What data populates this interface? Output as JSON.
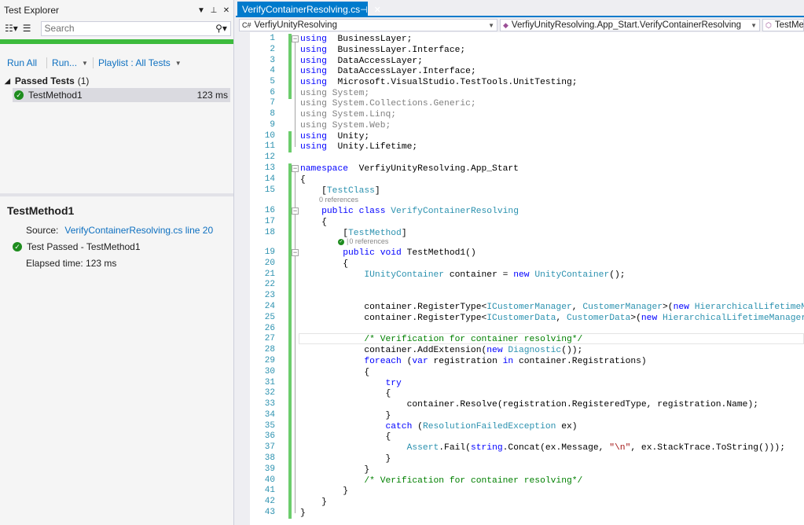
{
  "test_explorer": {
    "title": "Test Explorer",
    "search_placeholder": "Search",
    "commands": {
      "run_all": "Run All",
      "run": "Run...",
      "playlist": "Playlist : All Tests"
    },
    "group": {
      "label": "Passed Tests",
      "count": "(1)"
    },
    "test": {
      "name": "TestMethod1",
      "duration": "123 ms"
    },
    "detail": {
      "title": "TestMethod1",
      "source_label": "Source:",
      "source_link": "VerifyContainerResolving.cs line 20",
      "result": "Test Passed - TestMethod1",
      "elapsed": "Elapsed time: 123 ms"
    }
  },
  "editor": {
    "tab_title": "VerifyContainerResolving.cs",
    "nav": {
      "project": "VerfiyUnityResolving",
      "class": "VerfiyUnityResolving.App_Start.VerifyContainerResolving",
      "member": "TestMet"
    },
    "codelens": {
      "refs1": "0 references",
      "refs2": "0 references"
    },
    "lines": [
      [
        [
          "kw",
          "using"
        ],
        [
          "",
          "  BusinessLayer;"
        ]
      ],
      [
        [
          "kw",
          "using"
        ],
        [
          "",
          "  BusinessLayer.Interface;"
        ]
      ],
      [
        [
          "kw",
          "using"
        ],
        [
          "",
          "  DataAccessLayer;"
        ]
      ],
      [
        [
          "kw",
          "using"
        ],
        [
          "",
          "  DataAccessLayer.Interface;"
        ]
      ],
      [
        [
          "kw",
          "using"
        ],
        [
          "",
          "  Microsoft.VisualStudio.TestTools.UnitTesting;"
        ]
      ],
      [
        [
          "gr",
          "using System;"
        ]
      ],
      [
        [
          "gr",
          "using System.Collections.Generic;"
        ]
      ],
      [
        [
          "gr",
          "using System.Linq;"
        ]
      ],
      [
        [
          "gr",
          "using System.Web;"
        ]
      ],
      [
        [
          "kw",
          "using"
        ],
        [
          "",
          "  Unity;"
        ]
      ],
      [
        [
          "kw",
          "using"
        ],
        [
          "",
          "  Unity.Lifetime;"
        ]
      ],
      [
        [
          "",
          ""
        ]
      ],
      [
        [
          "kw",
          "namespace"
        ],
        [
          "",
          "  VerfiyUnityResolving.App_Start"
        ]
      ],
      [
        [
          "",
          "{"
        ]
      ],
      [
        [
          "",
          "    ["
        ],
        [
          "ty",
          "TestClass"
        ],
        [
          "",
          "]"
        ]
      ],
      [
        [
          "",
          "    "
        ],
        [
          "kw",
          "public"
        ],
        [
          "",
          " "
        ],
        [
          "kw",
          "class"
        ],
        [
          "",
          " "
        ],
        [
          "ty",
          "VerifyContainerResolving"
        ]
      ],
      [
        [
          "",
          "    {"
        ]
      ],
      [
        [
          "",
          "        ["
        ],
        [
          "ty",
          "TestMethod"
        ],
        [
          "",
          "]"
        ]
      ],
      [
        [
          "",
          "        "
        ],
        [
          "kw",
          "public"
        ],
        [
          "",
          " "
        ],
        [
          "kw",
          "void"
        ],
        [
          "",
          " TestMethod1()"
        ]
      ],
      [
        [
          "",
          "        {"
        ]
      ],
      [
        [
          "",
          "            "
        ],
        [
          "ty",
          "IUnityContainer"
        ],
        [
          "",
          " container = "
        ],
        [
          "kw",
          "new"
        ],
        [
          "",
          " "
        ],
        [
          "ty",
          "UnityContainer"
        ],
        [
          "",
          "();"
        ]
      ],
      [
        [
          "",
          ""
        ]
      ],
      [
        [
          "",
          ""
        ]
      ],
      [
        [
          "",
          "            container.RegisterType<"
        ],
        [
          "ty",
          "ICustomerManager"
        ],
        [
          "",
          ", "
        ],
        [
          "ty",
          "CustomerManager"
        ],
        [
          "",
          ">("
        ],
        [
          "kw",
          "new"
        ],
        [
          "",
          " "
        ],
        [
          "ty",
          "HierarchicalLifetimeManager"
        ],
        [
          "",
          "());"
        ]
      ],
      [
        [
          "",
          "            container.RegisterType<"
        ],
        [
          "ty",
          "ICustomerData"
        ],
        [
          "",
          ", "
        ],
        [
          "ty",
          "CustomerData"
        ],
        [
          "",
          ">("
        ],
        [
          "kw",
          "new"
        ],
        [
          "",
          " "
        ],
        [
          "ty",
          "HierarchicalLifetimeManager"
        ],
        [
          "",
          "());"
        ]
      ],
      [
        [
          "",
          ""
        ]
      ],
      [
        [
          "",
          "            "
        ],
        [
          "cm",
          "/* Verification for container resolving*/"
        ]
      ],
      [
        [
          "",
          "            container.AddExtension("
        ],
        [
          "kw",
          "new"
        ],
        [
          "",
          " "
        ],
        [
          "ty",
          "Diagnostic"
        ],
        [
          "",
          "());"
        ]
      ],
      [
        [
          "",
          "            "
        ],
        [
          "kw",
          "foreach"
        ],
        [
          "",
          " ("
        ],
        [
          "kw",
          "var"
        ],
        [
          "",
          " registration "
        ],
        [
          "kw",
          "in"
        ],
        [
          "",
          " container.Registrations)"
        ]
      ],
      [
        [
          "",
          "            {"
        ]
      ],
      [
        [
          "",
          "                "
        ],
        [
          "kw",
          "try"
        ]
      ],
      [
        [
          "",
          "                {"
        ]
      ],
      [
        [
          "",
          "                    container.Resolve(registration.RegisteredType, registration.Name);"
        ]
      ],
      [
        [
          "",
          "                }"
        ]
      ],
      [
        [
          "",
          "                "
        ],
        [
          "kw",
          "catch"
        ],
        [
          "",
          " ("
        ],
        [
          "ty",
          "ResolutionFailedException"
        ],
        [
          "",
          " ex)"
        ]
      ],
      [
        [
          "",
          "                {"
        ]
      ],
      [
        [
          "",
          "                    "
        ],
        [
          "ty",
          "Assert"
        ],
        [
          "",
          ".Fail("
        ],
        [
          "kw",
          "string"
        ],
        [
          "",
          ".Concat(ex.Message, "
        ],
        [
          "st",
          "\"\\n\""
        ],
        [
          "",
          ", ex.StackTrace.ToString()));"
        ]
      ],
      [
        [
          "",
          "                }"
        ]
      ],
      [
        [
          "",
          "            }"
        ]
      ],
      [
        [
          "",
          "            "
        ],
        [
          "cm",
          "/* Verification for container resolving*/"
        ]
      ],
      [
        [
          "",
          "        }"
        ]
      ],
      [
        [
          "",
          "    }"
        ]
      ],
      [
        [
          "",
          "}"
        ]
      ]
    ]
  }
}
